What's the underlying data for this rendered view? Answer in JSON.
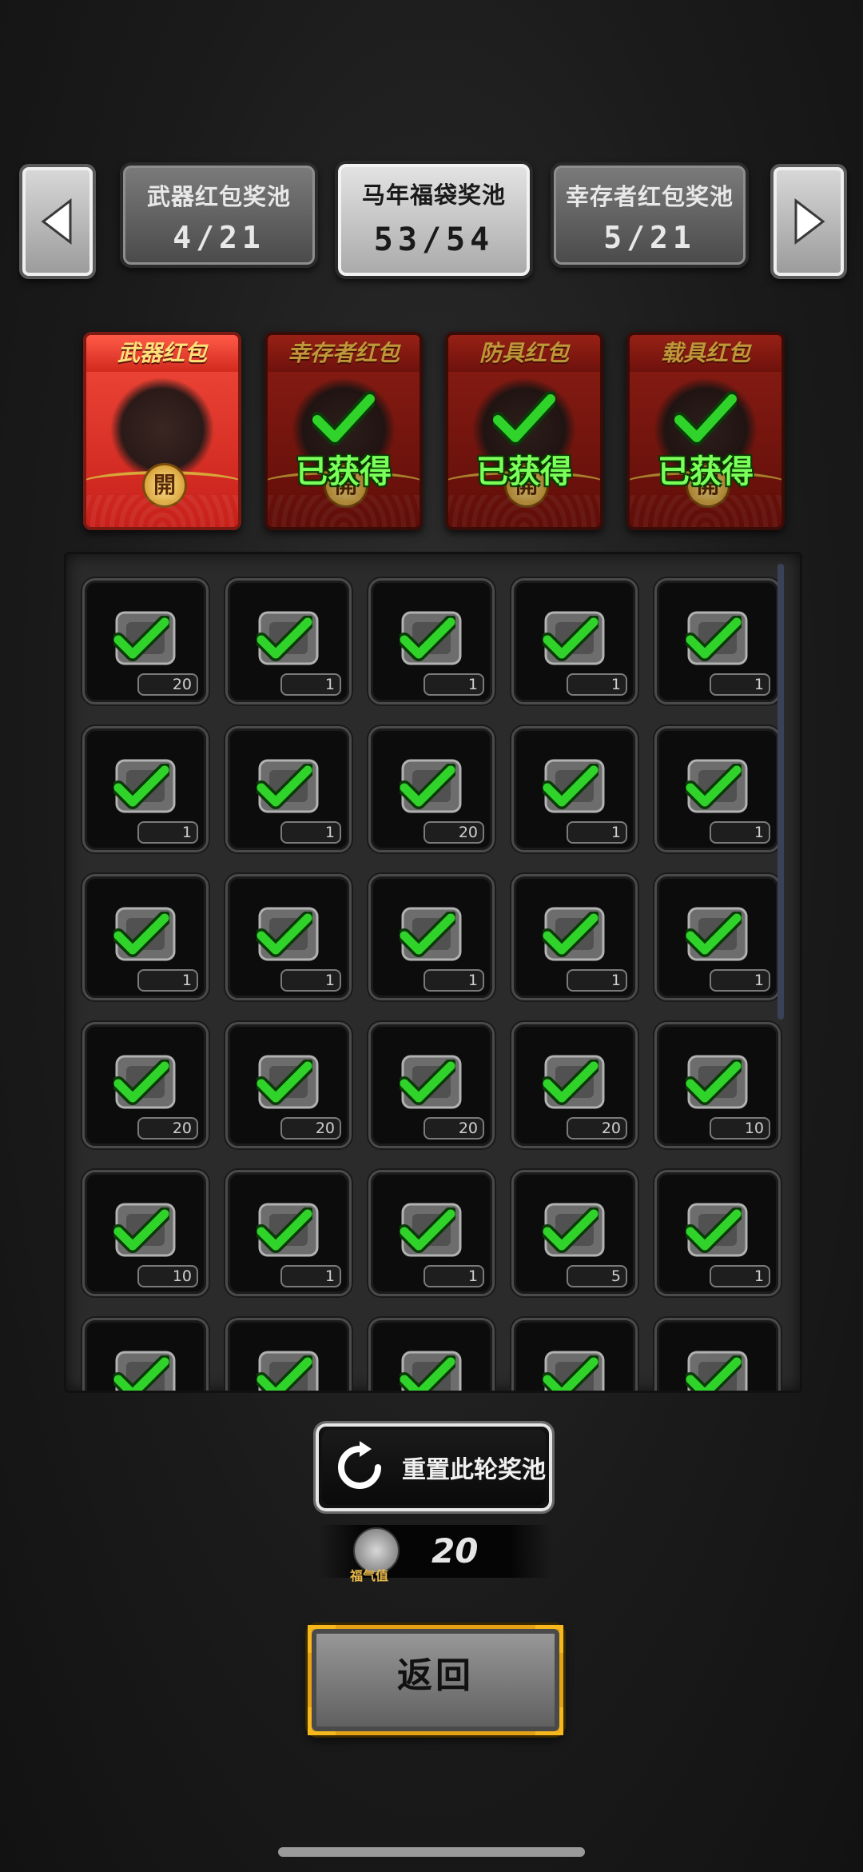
{
  "pool_tabs": [
    {
      "name": "武器红包奖池",
      "count": "4/21"
    },
    {
      "name": "马年福袋奖池",
      "count": "53/54"
    },
    {
      "name": "幸存者红包奖池",
      "count": "5/21"
    }
  ],
  "envelopes": [
    {
      "title": "武器红包",
      "status": "",
      "seal": "開"
    },
    {
      "title": "幸存者红包",
      "status": "已获得",
      "seal": "開"
    },
    {
      "title": "防具红包",
      "status": "已获得",
      "seal": "開"
    },
    {
      "title": "载具红包",
      "status": "已获得",
      "seal": "開"
    }
  ],
  "rewards": [
    {
      "icon": "shovel-icon",
      "qty": "20"
    },
    {
      "icon": "flask-icon",
      "qty": "1"
    },
    {
      "icon": "scrap-pieces-icon",
      "qty": "1"
    },
    {
      "icon": "wood-planks-icon",
      "qty": "1"
    },
    {
      "icon": "scrap-pile-icon",
      "qty": "1"
    },
    {
      "icon": "map-icon",
      "qty": "1"
    },
    {
      "icon": "knife-icon",
      "qty": "1"
    },
    {
      "icon": "cash-stack-icon",
      "qty": "20"
    },
    {
      "icon": "gold-bars-icon",
      "qty": "1"
    },
    {
      "icon": "vase-icon",
      "qty": "1"
    },
    {
      "icon": "ring-icon",
      "qty": "1"
    },
    {
      "icon": "food-bowl-icon",
      "qty": "1"
    },
    {
      "icon": "coffee-cup-icon",
      "qty": "1"
    },
    {
      "icon": "dumpling-bowl-icon",
      "qty": "1"
    },
    {
      "icon": "food-bag-icon",
      "qty": "1"
    },
    {
      "icon": "battery-icon",
      "qty": "20"
    },
    {
      "icon": "bullet-icon",
      "qty": "20"
    },
    {
      "icon": "fuel-barrel-icon",
      "qty": "20"
    },
    {
      "icon": "rifle-round-icon",
      "qty": "20"
    },
    {
      "icon": "syringe-icon",
      "qty": "10"
    },
    {
      "icon": "flashlight-icon",
      "qty": "10"
    },
    {
      "icon": "drink-cup-icon",
      "qty": "1"
    },
    {
      "icon": "jar-icon",
      "qty": "1"
    },
    {
      "icon": "globe-net-icon",
      "qty": "5"
    },
    {
      "icon": "juice-glass-icon",
      "qty": "1"
    },
    {
      "icon": "net-ball-icon",
      "qty": ""
    },
    {
      "icon": "blade-icon",
      "qty": ""
    },
    {
      "icon": "cloth-stack-icon",
      "qty": ""
    },
    {
      "icon": "helmet-icon",
      "qty": ""
    },
    {
      "icon": "bottle-icon",
      "qty": ""
    }
  ],
  "reset_button": {
    "label": "重置此轮奖池",
    "icon": "refresh-icon"
  },
  "luck": {
    "label": "福气值",
    "value": "20",
    "icon": "horse-coin-icon"
  },
  "return_button": {
    "label": "返回"
  },
  "colors": {
    "check_green": "#2fd32a",
    "envelope_red": "#c7201a",
    "gold_frame": "#e4a316"
  }
}
